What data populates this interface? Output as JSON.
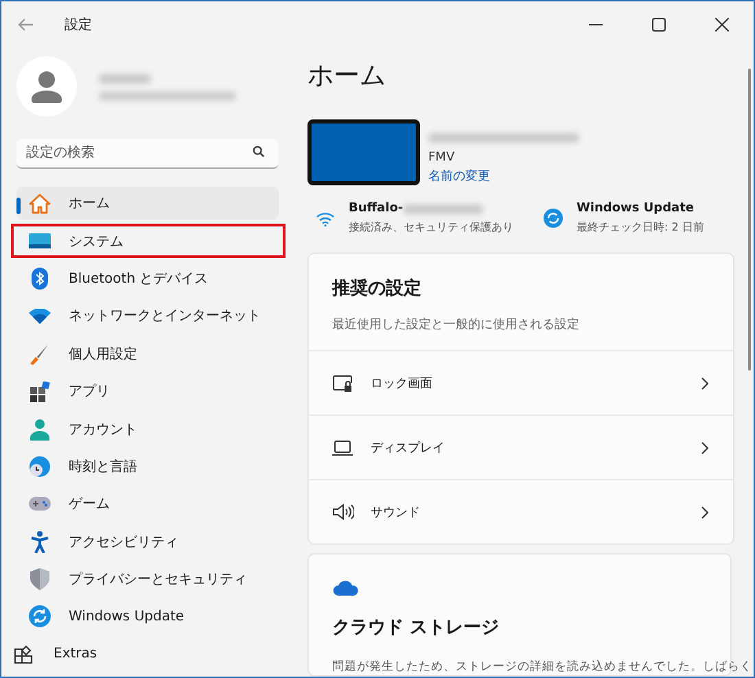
{
  "window": {
    "title": "設定"
  },
  "search": {
    "placeholder": "設定の検索"
  },
  "nav": [
    {
      "label": "ホーム",
      "selected": true,
      "highlighted": false
    },
    {
      "label": "システム",
      "selected": false,
      "highlighted": true
    },
    {
      "label": "Bluetooth とデバイス",
      "selected": false,
      "highlighted": false
    },
    {
      "label": "ネットワークとインターネット",
      "selected": false,
      "highlighted": false
    },
    {
      "label": "個人用設定",
      "selected": false,
      "highlighted": false
    },
    {
      "label": "アプリ",
      "selected": false,
      "highlighted": false
    },
    {
      "label": "アカウント",
      "selected": false,
      "highlighted": false
    },
    {
      "label": "時刻と言語",
      "selected": false,
      "highlighted": false
    },
    {
      "label": "ゲーム",
      "selected": false,
      "highlighted": false
    },
    {
      "label": "アクセシビリティ",
      "selected": false,
      "highlighted": false
    },
    {
      "label": "プライバシーとセキュリティ",
      "selected": false,
      "highlighted": false
    },
    {
      "label": "Windows Update",
      "selected": false,
      "highlighted": false
    }
  ],
  "extras": "Extras",
  "page_title": "ホーム",
  "device": {
    "model": "FMV",
    "rename_link": "名前の変更"
  },
  "status": [
    {
      "title": "Buffalo-",
      "subtitle": "接続済み、セキュリティ保護あり"
    },
    {
      "title": "Windows Update",
      "subtitle": "最終チェック日時: 2 日前"
    }
  ],
  "recommended": {
    "title": "推奨の設定",
    "subtitle": "最近使用した設定と一般的に使用される設定",
    "rows": [
      {
        "label": "ロック画面"
      },
      {
        "label": "ディスプレイ"
      },
      {
        "label": "サウンド"
      }
    ]
  },
  "cloud": {
    "title": "クラウド ストレージ",
    "text": "問題が発生したため、ストレージの詳細を読み込めませんでした。しばらく"
  }
}
